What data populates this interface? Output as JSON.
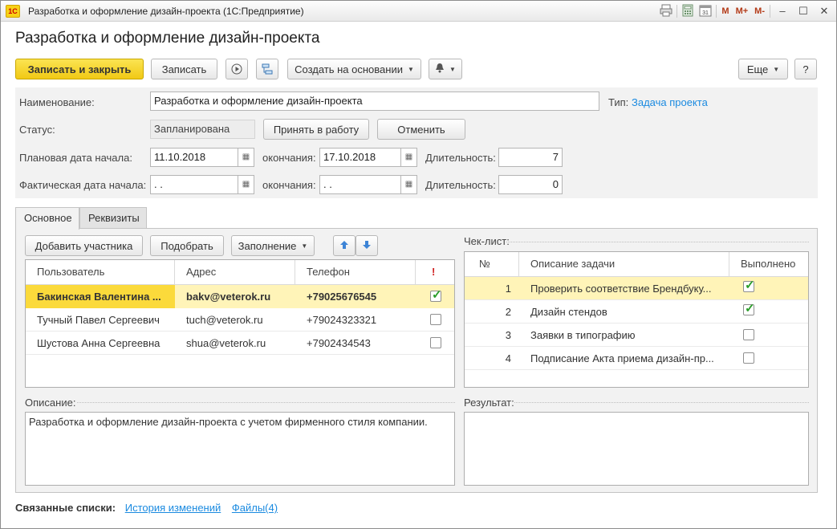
{
  "window": {
    "title": "Разработка и оформление дизайн-проекта  (1С:Предприятие)",
    "logo_text": "1С",
    "toolbar_icons": [
      "print-icon",
      "calculator-icon",
      "calendar-icon"
    ],
    "m_buttons": [
      "M",
      "M+",
      "M-"
    ]
  },
  "page_title": "Разработка и оформление дизайн-проекта",
  "command_bar": {
    "save_close": "Записать и закрыть",
    "save": "Записать",
    "create_based": "Создать на основании",
    "more": "Еще",
    "help": "?"
  },
  "form": {
    "name_label": "Наименование:",
    "name_value": "Разработка и оформление дизайн-проекта",
    "type_label": "Тип:",
    "type_value": "Задача проекта",
    "status_label": "Статус:",
    "status_value": "Запланирована",
    "accept_button": "Принять в работу",
    "cancel_button": "Отменить",
    "plan_start_label": "Плановая дата начала:",
    "plan_start_value": "11.10.2018",
    "plan_end_label": "окончания:",
    "plan_end_value": "17.10.2018",
    "plan_duration_label": "Длительность:",
    "plan_duration_value": "7",
    "fact_start_label": "Фактическая дата начала:",
    "fact_start_value": " .  .",
    "fact_end_label": "окончания:",
    "fact_end_value": " .  .",
    "fact_duration_label": "Длительность:",
    "fact_duration_value": "0"
  },
  "tabs": [
    {
      "label": "Основное",
      "active": true
    },
    {
      "label": "Реквизиты",
      "active": false
    }
  ],
  "participants": {
    "add_button": "Добавить участника",
    "pick_button": "Подобрать",
    "fill_button": "Заполнение",
    "columns": [
      "Пользователь",
      "Адрес",
      "Телефон",
      "!"
    ],
    "rows": [
      {
        "user": "Бакинская Валентина ...",
        "address": "bakv@veterok.ru",
        "phone": "+79025676545",
        "checked": true
      },
      {
        "user": "Тучный Павел Сергеевич",
        "address": "tuch@veterok.ru",
        "phone": "+79024323321",
        "checked": false
      },
      {
        "user": "Шустова Анна Сергеевна",
        "address": "shua@veterok.ru",
        "phone": "+7902434543",
        "checked": false
      }
    ]
  },
  "checklist": {
    "label": "Чек-лист:",
    "columns": [
      "№",
      "Описание задачи",
      "Выполнено"
    ],
    "rows": [
      {
        "n": "1",
        "task": "Проверить соответствие Брендбуку...",
        "done": true
      },
      {
        "n": "2",
        "task": "Дизайн стендов",
        "done": true
      },
      {
        "n": "3",
        "task": "Заявки в типографию",
        "done": false
      },
      {
        "n": "4",
        "task": "Подписание Акта приема дизайн-пр...",
        "done": false
      }
    ]
  },
  "description": {
    "label": "Описание:",
    "text": "Разработка и оформление дизайн-проекта с учетом фирменного стиля компании."
  },
  "result": {
    "label": "Результат:",
    "text": ""
  },
  "related": {
    "label": "Связанные списки:",
    "history": "История изменений",
    "files": "Файлы(4)"
  },
  "colors": {
    "accent_yellow": "#f1c915",
    "link_blue": "#1a8ae0",
    "selected_row": "#fbda3b",
    "check_green": "#2a9d2a",
    "warning_red": "#d02020"
  }
}
